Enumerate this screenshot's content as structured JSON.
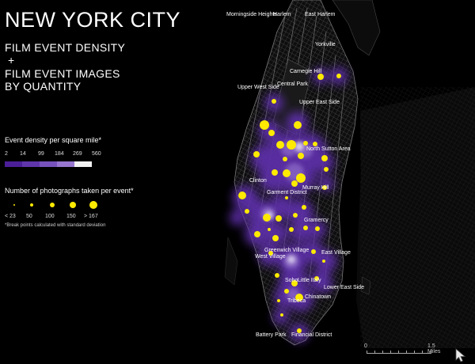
{
  "title": {
    "main": "NEW YORK CITY",
    "line1": "FILM EVENT DENSITY",
    "plus": "+",
    "line2": "FILM EVENT IMAGES",
    "line3": "BY QUANTITY"
  },
  "density_legend": {
    "title": "Event density per square mile*",
    "breaks": [
      "2",
      "14",
      "99",
      "184",
      "269",
      "560"
    ],
    "colors": [
      "#4b1f98",
      "#5f35ab",
      "#7752bd",
      "#9676cf",
      "#bfa9e2",
      "#f2f2f2"
    ]
  },
  "photo_legend": {
    "title": "Number of photographs taken per event*",
    "labels": [
      "< 23",
      "50",
      "100",
      "150",
      "> 167"
    ],
    "dot_color": "#ffea00"
  },
  "footnote": "*Break points calculated with standard deviation",
  "scale": {
    "start": "0",
    "end": "1.5 Miles"
  },
  "neighborhoods": [
    "Morningside Heights",
    "Harlem",
    "East Harlem",
    "Yorkville",
    "Carnegie Hill",
    "Upper West Side",
    "Central Park",
    "Upper East Side",
    "North Sutton Area",
    "Clinton",
    "Garment District",
    "Murray Hill",
    "Gramercy",
    "Greenwich Village",
    "East Village",
    "West Village",
    "Soho",
    "Little Italy",
    "Lower East Side",
    "Chinatown",
    "Tribeca",
    "Battery Park",
    "Financial District"
  ],
  "colors": {
    "background": "#000000",
    "density_glow": "#5b2ea6",
    "hotspot": "#e8e0f5",
    "event_dot": "#ffea00",
    "streets": "#5a5a5a"
  }
}
